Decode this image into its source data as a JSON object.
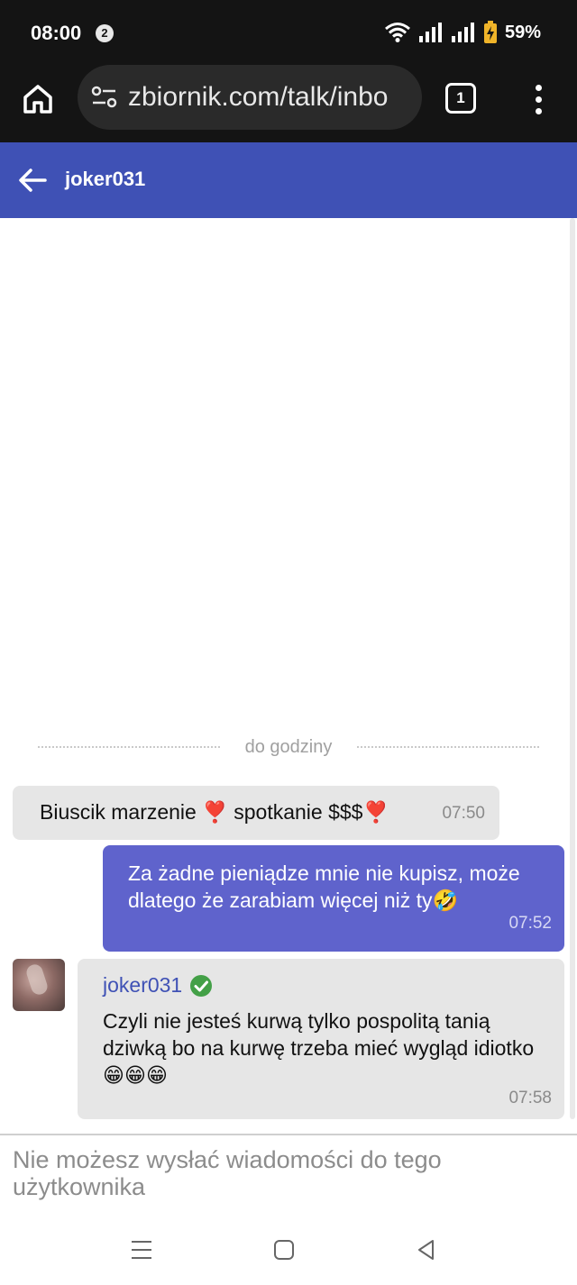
{
  "status_bar": {
    "time": "08:00",
    "notification_count": "2",
    "battery": "59%"
  },
  "browser": {
    "url": "zbiornik.com/talk/inbo",
    "tab_count": "1"
  },
  "header": {
    "title": "joker031"
  },
  "chat": {
    "date_separator": "do godziny",
    "messages": [
      {
        "text": "Biuscik marzenie ❣️ spotkanie $$$❣️",
        "time": "07:50"
      },
      {
        "text": "Za żadne pieniądze mnie nie kupisz, może dlatego że zarabiam więcej niż ty🤣",
        "time": "07:52"
      },
      {
        "sender": "joker031",
        "text": "Czyli nie jesteś kurwą tylko pospolitą tanią dziwką bo na kurwę trzeba mieć wygląd idiotko 😁😁😁",
        "time": "07:58"
      }
    ]
  },
  "composer": {
    "disabled_notice": "Nie możesz wysłać wiadomości do tego użytkownika"
  },
  "colors": {
    "header": "#3f51b5",
    "outgoing_bubble": "#5f63cc",
    "incoming_bubble": "#e6e6e6",
    "verified": "#43a047"
  }
}
